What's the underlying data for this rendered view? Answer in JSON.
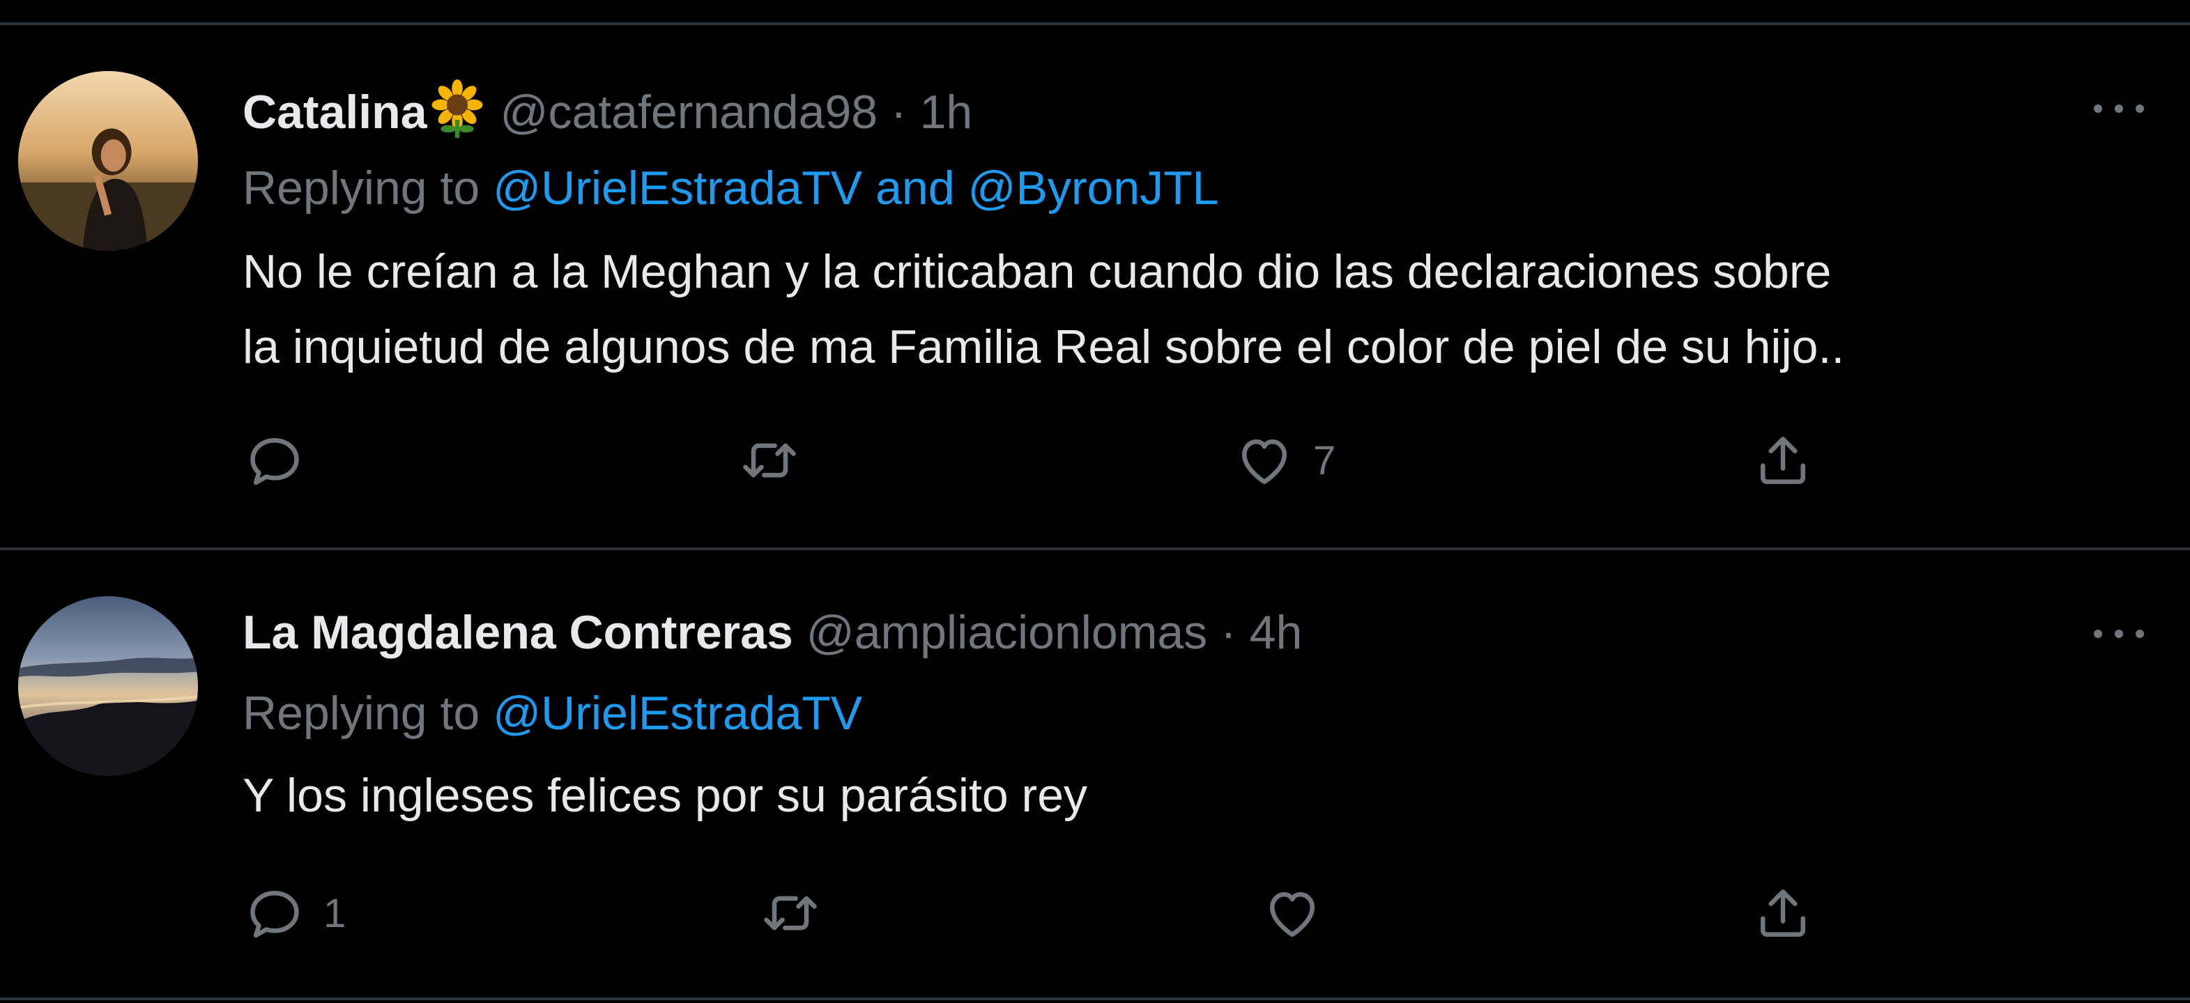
{
  "theme": {
    "background": "#000000",
    "text": "#e7e9ea",
    "muted": "#71767b",
    "link": "#1d9bf0",
    "divider": "#2f3336"
  },
  "tweets": [
    {
      "display_name": "Catalina",
      "name_emoji": "sunflower-emoji",
      "handle": "@catafernanda98",
      "separator": "·",
      "time": "1h",
      "replying_prefix": "Replying to",
      "replying_mention_1": "@UrielEstradaTV",
      "replying_joiner": "and",
      "replying_mention_2": "@ByronJTL",
      "text_line_1": "No le creían a la Meghan y la criticaban  cuando dio las declaraciones sobre",
      "text_line_2": "la inquietud de algunos de ma Familia Real sobre el color de piel de su hijo..",
      "reply_count": "",
      "retweet_count": "",
      "like_count": "7",
      "icons": [
        "more-icon",
        "reply-icon",
        "retweet-icon",
        "like-icon",
        "share-icon"
      ]
    },
    {
      "display_name": "La Magdalena Contreras",
      "handle": "@ampliacionlomas",
      "separator": "·",
      "time": "4h",
      "replying_prefix": "Replying to",
      "replying_mention_1": "@UrielEstradaTV",
      "text_line_1": "Y los ingleses felices por su parásito rey",
      "reply_count": "1",
      "retweet_count": "",
      "like_count": "",
      "icons": [
        "more-icon",
        "reply-icon",
        "retweet-icon",
        "like-icon",
        "share-icon"
      ]
    }
  ]
}
